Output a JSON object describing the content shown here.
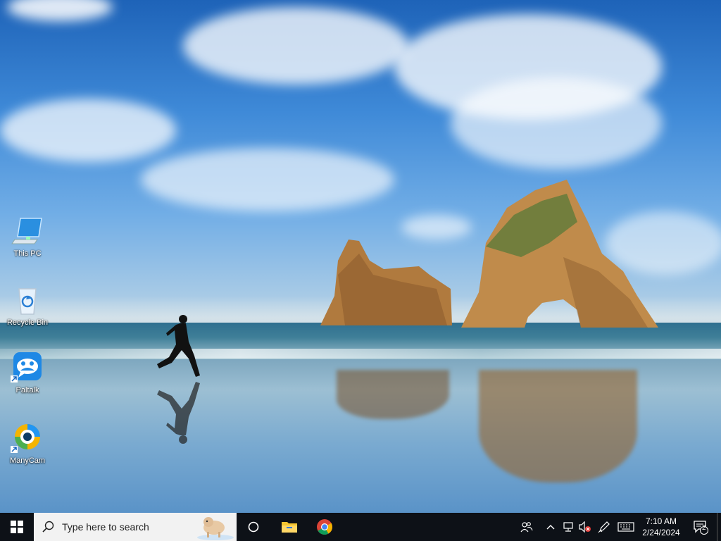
{
  "desktop": {
    "icons": [
      {
        "label": "This PC",
        "icon": "monitor-icon"
      },
      {
        "label": "Recycle Bin",
        "icon": "recycle-bin-icon"
      },
      {
        "label": "Paltalk",
        "icon": "paltalk-icon"
      },
      {
        "label": "ManyCam",
        "icon": "manycam-icon"
      }
    ]
  },
  "taskbar": {
    "search_placeholder": "Type here to search",
    "pinned": [
      {
        "name": "Task View",
        "icon": "task-view-icon"
      },
      {
        "name": "File Explorer",
        "icon": "file-explorer-icon"
      },
      {
        "name": "Google Chrome",
        "icon": "chrome-icon"
      }
    ],
    "clock": {
      "time": "7:10 AM",
      "date": "2/24/2024"
    },
    "notification_count": "2",
    "colors": {
      "taskbar": "#0d1117",
      "search_bg": "#f2f2f2",
      "accent": "#0078d7"
    }
  }
}
